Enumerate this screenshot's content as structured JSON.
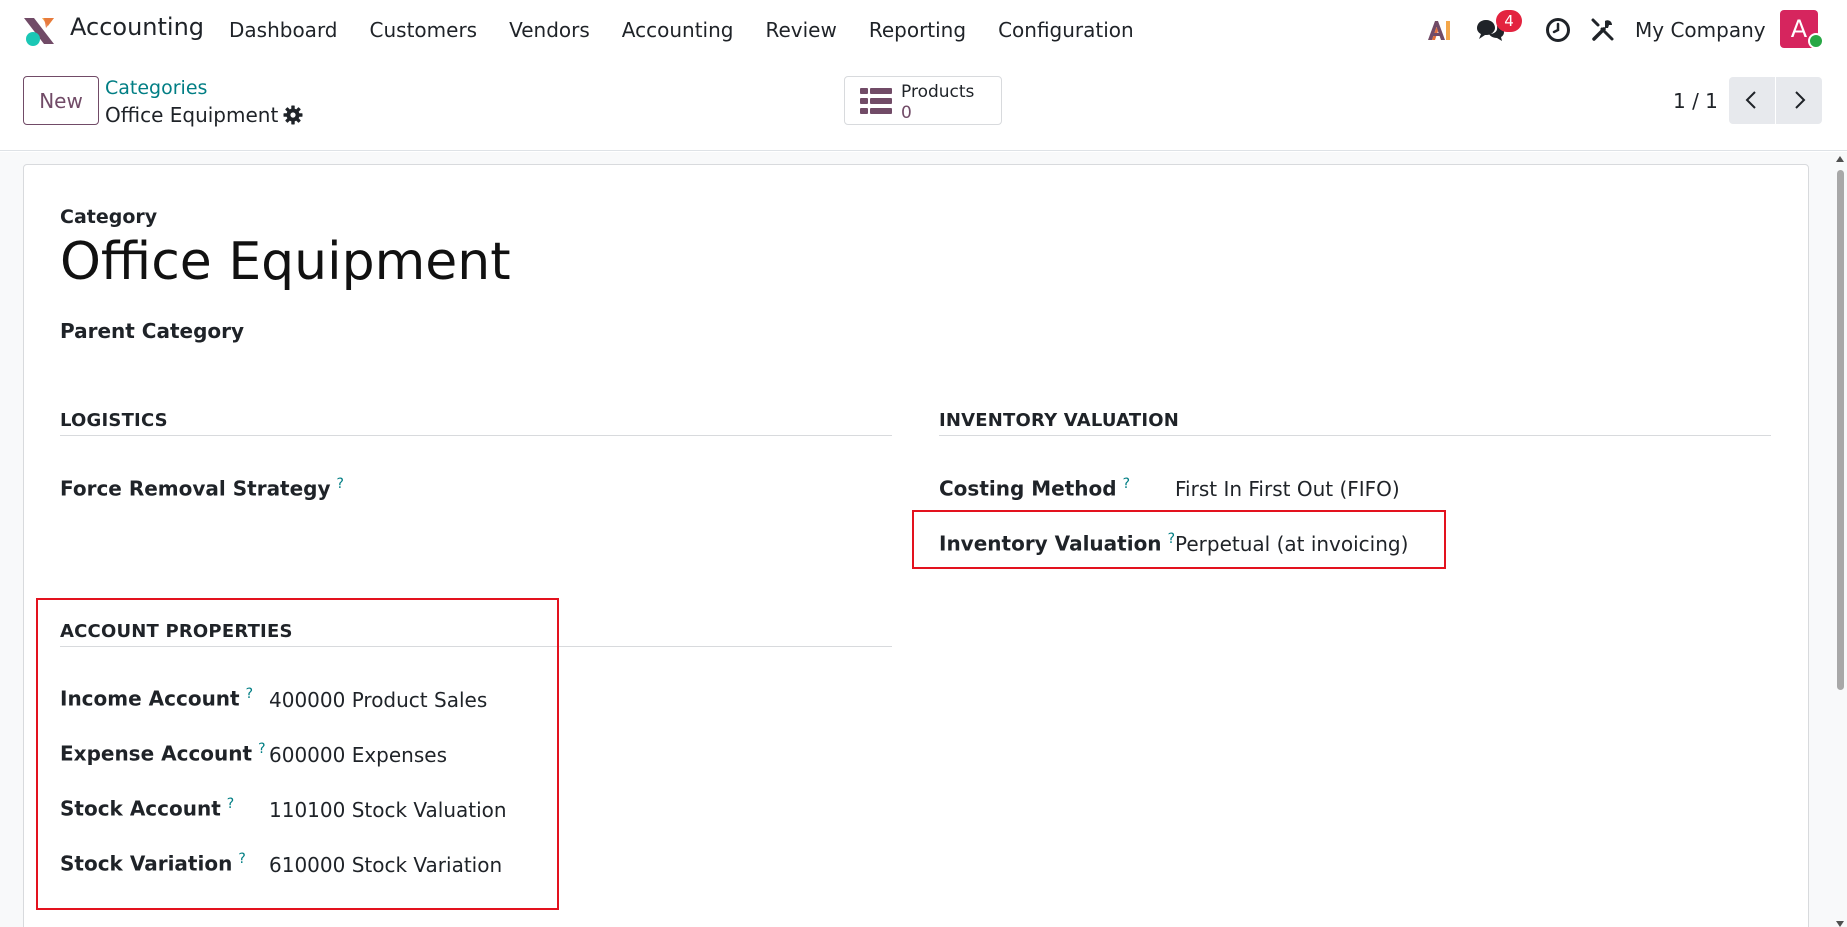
{
  "navbar": {
    "app_name": "Accounting",
    "menu": [
      "Dashboard",
      "Customers",
      "Vendors",
      "Accounting",
      "Review",
      "Reporting",
      "Configuration"
    ],
    "chat_badge": "4",
    "company": "My Company",
    "avatar_letter": "A"
  },
  "control_panel": {
    "new_label": "New",
    "breadcrumb": "Categories",
    "record_title": "Office Equipment",
    "smart_button": {
      "label": "Products",
      "value": "0"
    },
    "pager": "1 / 1"
  },
  "form": {
    "category_label": "Category",
    "category_name": "Office Equipment",
    "parent_label": "Parent Category",
    "logistics": {
      "title": "LOGISTICS",
      "removal_label": "Force Removal Strategy"
    },
    "valuation": {
      "title": "INVENTORY VALUATION",
      "costing_label": "Costing Method",
      "costing_value": "First In First Out (FIFO)",
      "valuation_label": "Inventory Valuation",
      "valuation_value": "Perpetual (at invoicing)"
    },
    "accounts": {
      "title": "ACCOUNT PROPERTIES",
      "income_label": "Income Account",
      "income_value": "400000 Product Sales",
      "expense_label": "Expense Account",
      "expense_value": "600000 Expenses",
      "stock_label": "Stock Account",
      "stock_value": "110100 Stock Valuation",
      "variation_label": "Stock Variation",
      "variation_value": "610000 Stock Variation"
    },
    "help_mark": "?"
  },
  "colors": {
    "brand": "#714b67",
    "link": "#017e84",
    "highlight": "#e3121e",
    "badge": "#e3233f"
  }
}
